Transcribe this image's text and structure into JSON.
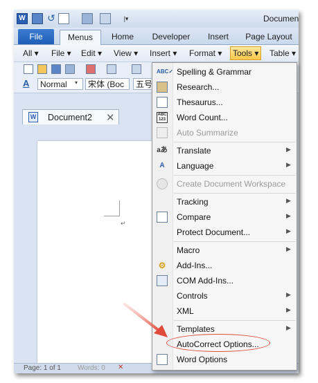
{
  "window": {
    "title": "Documen"
  },
  "ribbon_tabs": {
    "file": "File",
    "menus": "Menus",
    "home": "Home",
    "developer": "Developer",
    "insert": "Insert",
    "page_layout": "Page Layout"
  },
  "menubar": {
    "all": "All",
    "file": "File",
    "edit": "Edit",
    "view": "View",
    "insert": "Insert",
    "format": "Format",
    "tools": "Tools",
    "table": "Table"
  },
  "toolbar": {
    "style_value": "Normal",
    "font_value": "宋体 (Boc",
    "size_value": "五号"
  },
  "document": {
    "tab_label": "Document2"
  },
  "statusbar": {
    "page": "Page: 1 of 1",
    "words": "Words: 0"
  },
  "tools_menu": {
    "items": [
      {
        "label": "Spelling & Grammar",
        "icon": "spelling-icon"
      },
      {
        "label": "Research...",
        "icon": "research-icon"
      },
      {
        "label": "Thesaurus...",
        "icon": "thesaurus-icon"
      },
      {
        "label": "Word Count...",
        "icon": "word-count-icon"
      },
      {
        "label": "Auto Summarize",
        "icon": "auto-summarize-icon"
      },
      {
        "label": "Translate",
        "icon": "translate-icon"
      },
      {
        "label": "Language",
        "icon": "language-icon"
      },
      {
        "label": "Create Document Workspace",
        "icon": "workspace-icon"
      },
      {
        "label": "Tracking"
      },
      {
        "label": "Compare",
        "icon": "compare-icon"
      },
      {
        "label": "Protect Document..."
      },
      {
        "label": "Macro"
      },
      {
        "label": "Add-Ins...",
        "icon": "add-ins-icon"
      },
      {
        "label": "COM Add-Ins...",
        "icon": "com-add-ins-icon"
      },
      {
        "label": "Controls"
      },
      {
        "label": "XML"
      },
      {
        "label": "Templates"
      },
      {
        "label": "AutoCorrect Options..."
      },
      {
        "label": "Word Options",
        "icon": "word-options-icon"
      }
    ]
  },
  "colors": {
    "file_tab": "#2a6cc4",
    "tools_highlight": "#fcd467",
    "annotation_red": "#e04a3a"
  }
}
